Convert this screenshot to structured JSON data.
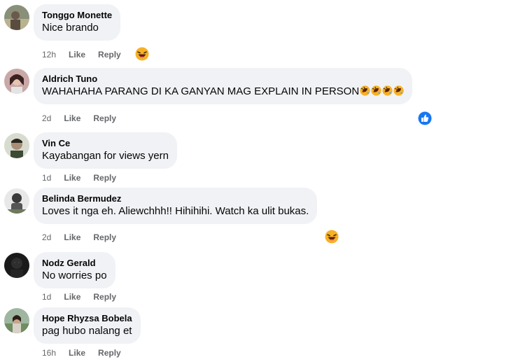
{
  "comments": [
    {
      "name": "Tonggo Monette",
      "text": "Nice brando",
      "time": "12h",
      "like": "Like",
      "reply": "Reply"
    },
    {
      "name": "Aldrich Tuno",
      "text": "WAHAHAHA PARANG DI KA GANYAN MAG EXPLAIN IN PERSON",
      "time": "2d",
      "like": "Like",
      "reply": "Reply"
    },
    {
      "name": "Vin Ce",
      "text": "Kayabangan for views yern",
      "time": "1d",
      "like": "Like",
      "reply": "Reply"
    },
    {
      "name": "Belinda Bermudez",
      "text": "Loves it nga eh. Aliewchhh!! Hihihihi. Watch ka ulit bukas.",
      "time": "2d",
      "like": "Like",
      "reply": "Reply"
    },
    {
      "name": "Nodz Gerald",
      "text": "No worries po",
      "time": "1d",
      "like": "Like",
      "reply": "Reply"
    },
    {
      "name": "Hope Rhyzsa Bobela",
      "text": "pag hubo nalang et",
      "time": "16h",
      "like": "Like",
      "reply": "Reply"
    }
  ],
  "icons": {
    "haha_reaction": "haha-reaction-icon",
    "rofl_emoji": "rolling-on-floor-laughing-emoji",
    "like_reaction": "like-reaction-icon"
  },
  "colors": {
    "bubble": "#f0f2f5",
    "secondary_text": "#65676b",
    "like_blue": "#1877f2",
    "haha_yellow": "#f7b125"
  }
}
